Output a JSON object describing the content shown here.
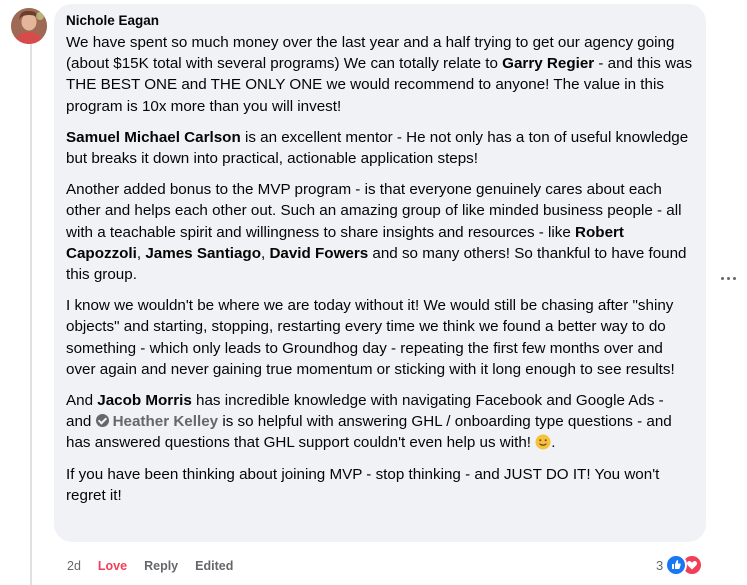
{
  "comment": {
    "author": "Nichole Eagan",
    "paragraphs": {
      "p1": {
        "a": "We have spent so much money over the last year and a half trying to get our agency going (about $15K total with several programs) We can totally relate to ",
        "m1": "Garry Regier",
        "b": " - and this was THE BEST ONE and THE ONLY ONE we would recommend to anyone! The value in this program is 10x more than you will invest!"
      },
      "p2": {
        "m1": "Samuel Michael Carlson",
        "a": " is an excellent mentor - He not only has a ton of useful knowledge but breaks it down into practical, actionable application steps!"
      },
      "p3": {
        "a": "Another added bonus to the MVP program - is that everyone genuinely cares about each other and helps each other out. Such an amazing group of like minded business people - all with a teachable spirit and willingness to share insights and resources - like ",
        "m1": "Robert Capozzoli",
        "s1": ", ",
        "m2": "James Santiago",
        "s2": ", ",
        "m3": "David Fowers",
        "b": " and so many others! So thankful to have found this group."
      },
      "p4": {
        "a": "I know we wouldn't be where we are today without it! We would still be chasing after \"shiny objects\" and starting, stopping, restarting every time we think we found a better way to do something - which only leads to Groundhog day - repeating the first few months over and over again and never gaining true momentum or sticking with it long enough to see results!"
      },
      "p5": {
        "a": "And ",
        "m1": "Jacob Morris",
        "b": " has incredible knowledge with navigating Facebook and Google Ads -",
        "c": "and ",
        "m2": "Heather Kelley",
        "d": " is so helpful with answering GHL / onboarding type questions - and has answered questions that GHL support couldn't even help us with! ",
        "e": "."
      },
      "p6": {
        "a": "If you have been thinking about joining MVP - stop thinking - and JUST DO IT! You won't regret it!"
      }
    },
    "emoji": "smiling-face-icon"
  },
  "actions": {
    "time": "2d",
    "love": "Love",
    "reply": "Reply",
    "edited": "Edited"
  },
  "reactions": {
    "count": "3",
    "types": [
      "like",
      "love"
    ]
  },
  "colors": {
    "bubble": "#f0f2f5",
    "love": "#f33e58",
    "like": "#1877f2",
    "muted": "#65676b"
  }
}
